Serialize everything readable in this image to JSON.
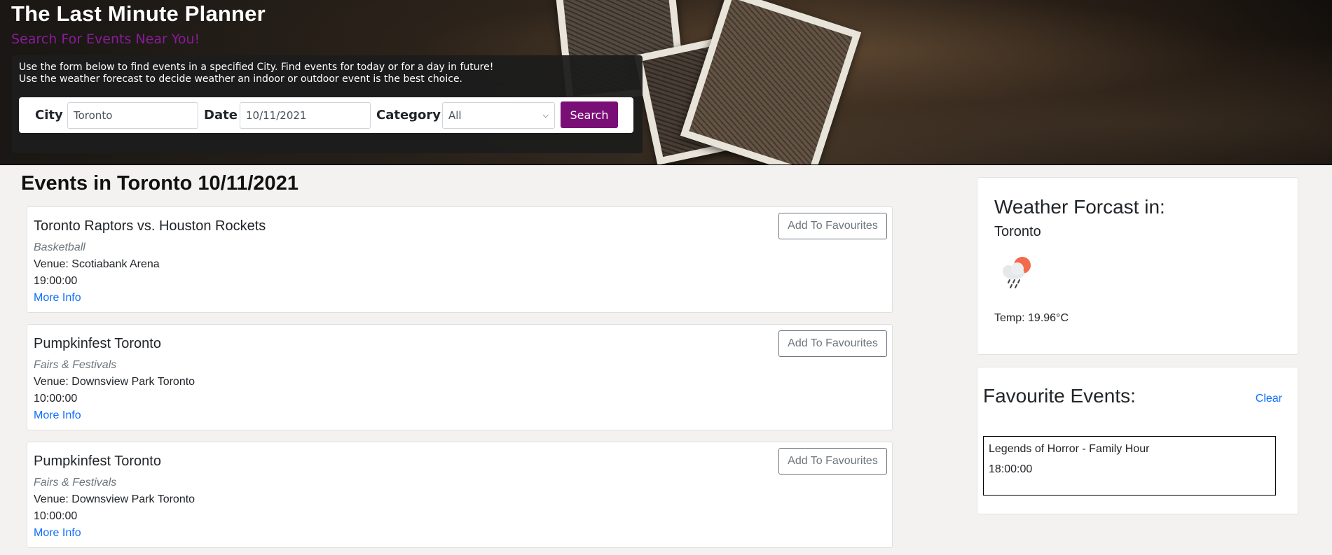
{
  "header": {
    "title": "The Last Minute Planner",
    "subtitle": "Search For Events Near You!",
    "info_line_1": "Use the form below to find events in a specified City. Find events for today or for a day in future!",
    "info_line_2": "Use the weather forecast to decide weather an indoor or outdoor event is the best choice."
  },
  "search_form": {
    "city_label": "City",
    "city_value": "Toronto",
    "date_label": "Date",
    "date_value": "10/11/2021",
    "category_label": "Category",
    "category_value": "All",
    "search_label": "Search"
  },
  "events": {
    "heading": "Events in Toronto 10/11/2021",
    "items": [
      {
        "title": "Toronto Raptors vs. Houston Rockets",
        "category": "Basketball",
        "venue": "Venue: Scotiabank Arena",
        "time": "19:00:00",
        "more_info": "More Info",
        "fav_label": "Add To Favourites"
      },
      {
        "title": "Pumpkinfest Toronto",
        "category": "Fairs & Festivals",
        "venue": "Venue: Downsview Park Toronto",
        "time": "10:00:00",
        "more_info": "More Info",
        "fav_label": "Add To Favourites"
      },
      {
        "title": "Pumpkinfest Toronto",
        "category": "Fairs & Festivals",
        "venue": "Venue: Downsview Park Toronto",
        "time": "10:00:00",
        "more_info": "More Info",
        "fav_label": "Add To Favourites"
      }
    ]
  },
  "weather": {
    "heading": "Weather Forcast in:",
    "city": "Toronto",
    "icon": "partly-sunny-rain-icon",
    "temp": "Temp: 19.96°C"
  },
  "favourites": {
    "heading": "Favourite Events:",
    "clear_label": "Clear",
    "items": [
      {
        "title": "Legends of Horror - Family Hour",
        "time": "18:00:00"
      }
    ]
  },
  "colors": {
    "accent": "#7a0e77",
    "subtitle": "#8a1b9a",
    "link": "#0d6efd",
    "page_bg": "#f3f2f1"
  }
}
